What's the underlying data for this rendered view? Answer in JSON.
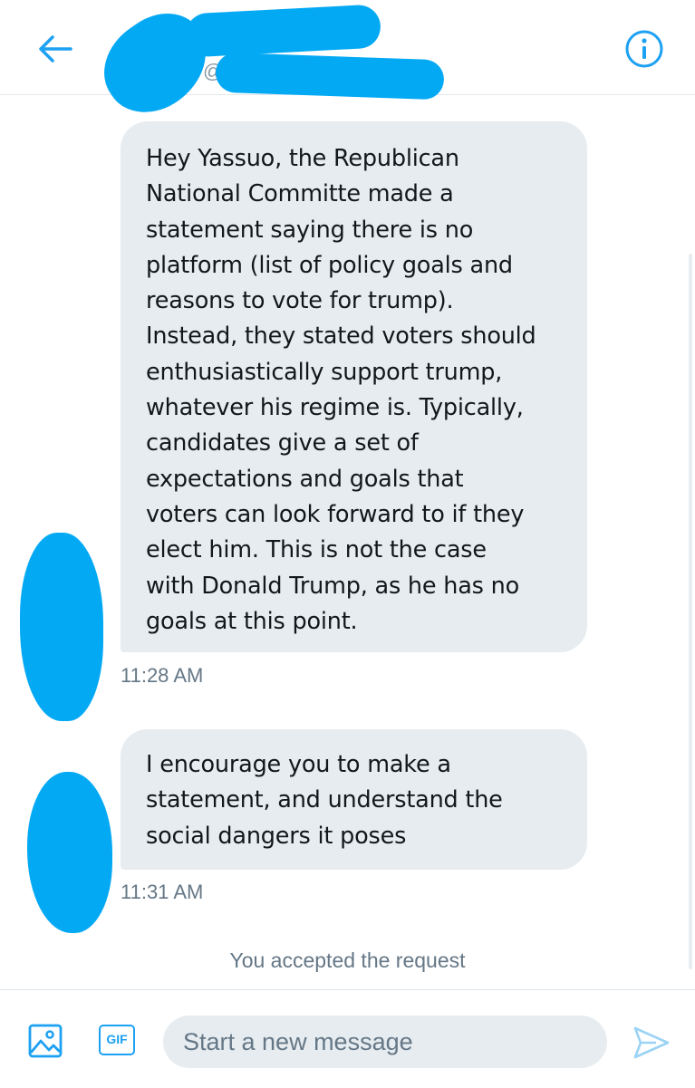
{
  "header": {
    "back_icon": "arrow-left-icon",
    "info_icon": "info-icon",
    "handle_prefix": "@",
    "accent_color": "#1da1f2",
    "redaction_color": "#04a9f4"
  },
  "messages": [
    {
      "text": "Hey Yassuo, the Republican\nNational Committe made a\nstatement saying there is no\nplatform (list of policy goals and\nreasons to vote for trump).\nInstead, they stated voters should\nenthusiastically support trump,\nwhatever his regime is. Typically,\ncandidates give a set of\nexpectations and goals that\nvoters can look forward to if they\nelect him. This is not the case\nwith Donald Trump, as he has no\ngoals at this point.",
      "time": "11:28 AM"
    },
    {
      "text": "I encourage you to make a\nstatement, and understand the\nsocial dangers it poses",
      "time": "11:31 AM"
    }
  ],
  "system_note": "You accepted the request",
  "composer": {
    "media_icon": "image-icon",
    "gif_label": "GIF",
    "placeholder": "Start a new message",
    "send_icon": "send-icon"
  }
}
